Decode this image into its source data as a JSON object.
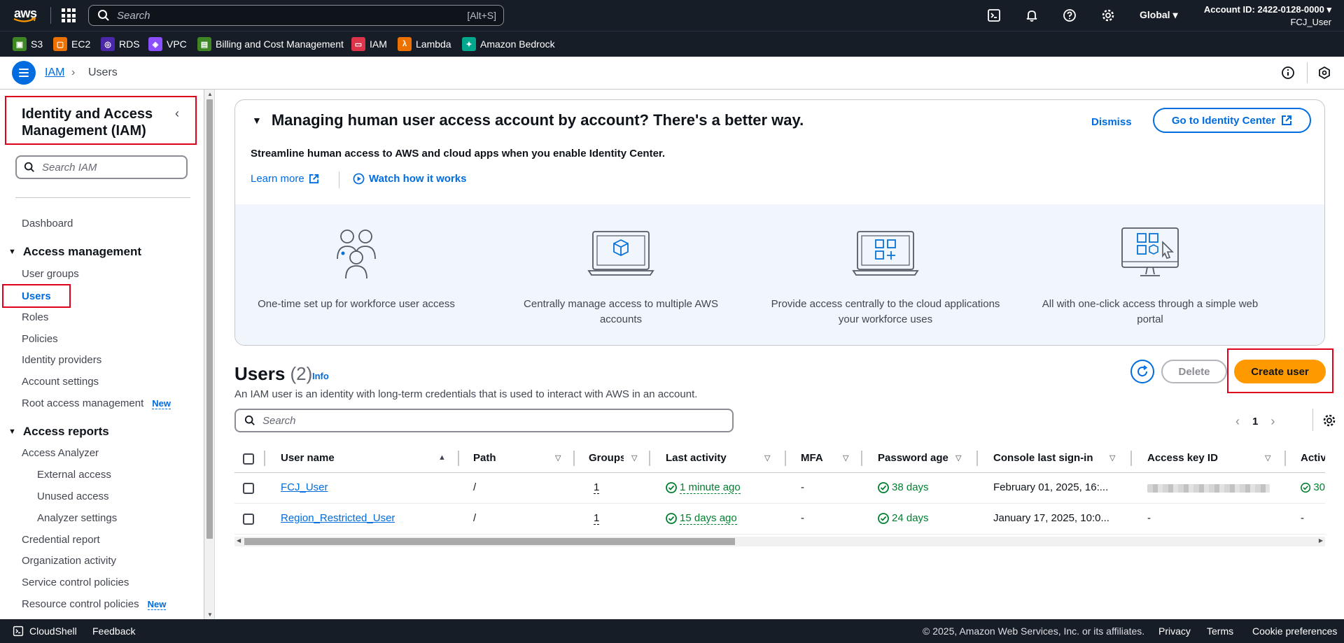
{
  "topnav": {
    "logo": "aws",
    "search_placeholder": "Search",
    "search_shortcut": "[Alt+S]",
    "region": "Global",
    "account_id": "Account ID: 2422-0128-0000",
    "username": "FCJ_User"
  },
  "favorites": [
    {
      "label": "S3",
      "color": "#3f8624"
    },
    {
      "label": "EC2",
      "color": "#ed7100"
    },
    {
      "label": "RDS",
      "color": "#4d27aa"
    },
    {
      "label": "VPC",
      "color": "#8c4fff"
    },
    {
      "label": "Billing and Cost Management",
      "color": "#3f8624"
    },
    {
      "label": "IAM",
      "color": "#dd344c"
    },
    {
      "label": "Lambda",
      "color": "#ed7100"
    },
    {
      "label": "Amazon Bedrock",
      "color": "#01a88d"
    }
  ],
  "breadcrumb": {
    "root": "IAM",
    "current": "Users"
  },
  "sidebar": {
    "title": "Identity and Access Management (IAM)",
    "search_placeholder": "Search IAM",
    "dashboard": "Dashboard",
    "access_management": "Access management",
    "am_items": [
      "User groups",
      "Users",
      "Roles",
      "Policies",
      "Identity providers",
      "Account settings",
      "Root access management"
    ],
    "new_badge": "New",
    "access_reports": "Access reports",
    "ar_items": [
      "Access Analyzer",
      "External access",
      "Unused access",
      "Analyzer settings",
      "Credential report",
      "Organization activity",
      "Service control policies",
      "Resource control policies"
    ]
  },
  "banner": {
    "heading": "Managing human user access account by account? There's a better way.",
    "dismiss": "Dismiss",
    "go_button": "Go to Identity Center",
    "subtext": "Streamline human access to AWS and cloud apps when you enable Identity Center.",
    "learn_more": "Learn more",
    "watch": "Watch how it works",
    "features": [
      "One-time set up for workforce user access",
      "Centrally manage access to multiple AWS accounts",
      "Provide access centrally to the cloud applications your workforce uses",
      "All with one-click access through a simple web portal"
    ]
  },
  "users": {
    "title": "Users",
    "count": "(2)",
    "info": "Info",
    "description": "An IAM user is an identity with long-term credentials that is used to interact with AWS in an account.",
    "delete": "Delete",
    "create": "Create user",
    "search_placeholder": "Search",
    "page": "1",
    "columns": [
      "User name",
      "Path",
      "Groups",
      "Last activity",
      "MFA",
      "Password age",
      "Console last sign-in",
      "Access key ID",
      "Active"
    ],
    "rows": [
      {
        "name": "FCJ_User",
        "path": "/",
        "groups": "1",
        "last_activity": "1 minute ago",
        "mfa": "-",
        "password_age": "38 days",
        "console_sign_in": "February 01, 2025, 16:...",
        "access_key": "",
        "active": "30"
      },
      {
        "name": "Region_Restricted_User",
        "path": "/",
        "groups": "1",
        "last_activity": "15 days ago",
        "mfa": "-",
        "password_age": "24 days",
        "console_sign_in": "January 17, 2025, 10:0...",
        "access_key": "-",
        "active": "-"
      }
    ]
  },
  "footer": {
    "cloudshell": "CloudShell",
    "feedback": "Feedback",
    "copyright": "© 2025, Amazon Web Services, Inc. or its affiliates.",
    "privacy": "Privacy",
    "terms": "Terms",
    "cookies": "Cookie preferences"
  }
}
